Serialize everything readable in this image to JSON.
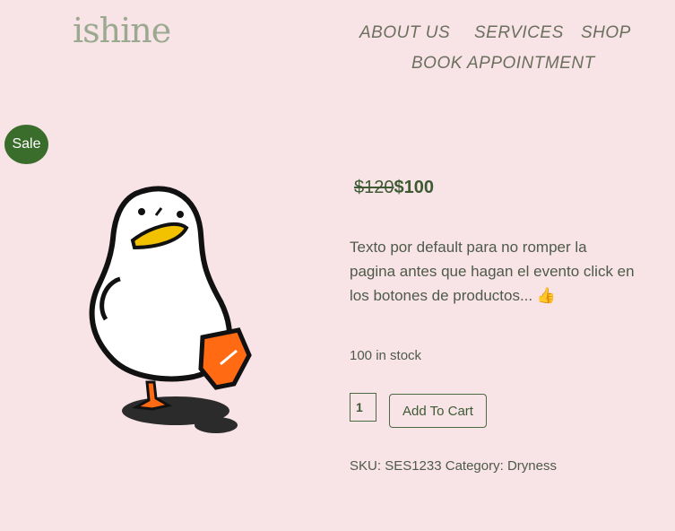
{
  "header": {
    "logo": "ishine",
    "nav": [
      "ABOUT US",
      "SERVICES",
      "SHOP",
      "BOOK APPOINTMENT"
    ]
  },
  "product": {
    "badge": "Sale",
    "price_old": "$120",
    "price_new": "$100",
    "description": "Texto por default para no romper la pagina antes que hagan el evento click en los botones de productos... 👍",
    "stock": "100 in stock",
    "quantity": "1",
    "add_to_cart": "Add To Cart",
    "sku_label": "SKU:",
    "sku": "SES1233",
    "category_label": "Category:",
    "category": "Dryness",
    "image_icon": "duck-illustration"
  },
  "colors": {
    "background": "#f8e4e6",
    "accent": "#3a6d2b",
    "logo": "#9aa98f"
  }
}
